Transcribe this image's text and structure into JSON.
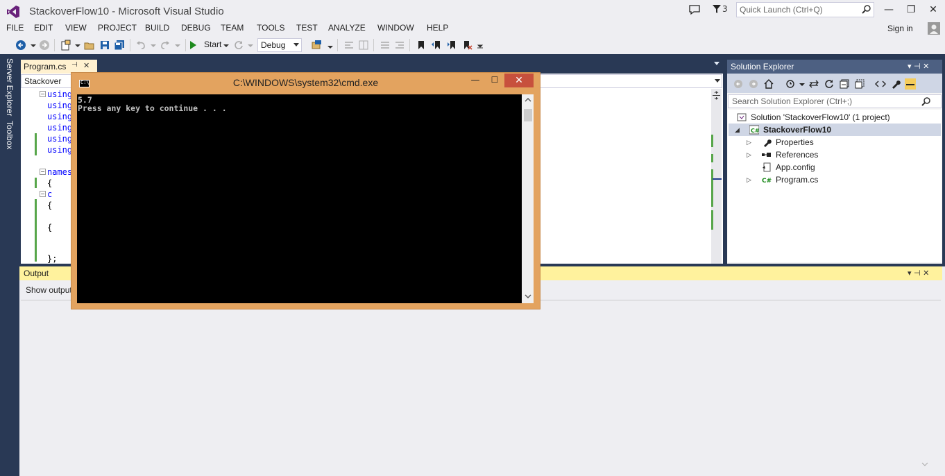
{
  "title_bar": {
    "title": "StackoverFlow10 - Microsoft Visual Studio",
    "filter_count": "3",
    "quick_launch_placeholder": "Quick Launch (Ctrl+Q)",
    "minimize": "—",
    "maximize": "❐",
    "close": "✕"
  },
  "menu": {
    "items": [
      "FILE",
      "EDIT",
      "VIEW",
      "PROJECT",
      "BUILD",
      "DEBUG",
      "TEAM",
      "TOOLS",
      "TEST",
      "ANALYZE",
      "WINDOW",
      "HELP"
    ],
    "sign_in": "Sign in"
  },
  "toolbar": {
    "start_label": "Start",
    "configuration": "Debug"
  },
  "left_tabs": {
    "server_explorer": "Server Explorer",
    "toolbox": "Toolbox"
  },
  "editor": {
    "tab_label": "Program.cs",
    "tab_pin": "⊣",
    "tab_close": "✕",
    "nav_left": "Stackover",
    "lines": [
      {
        "text": "using",
        "kind": "kw"
      },
      {
        "text": "using",
        "kind": "kw"
      },
      {
        "text": "using",
        "kind": "kw"
      },
      {
        "text": "using",
        "kind": "kw"
      },
      {
        "text": "using",
        "kind": "kw"
      },
      {
        "text": "using",
        "kind": "kw"
      },
      {
        "text": "names",
        "kind": "kw"
      },
      {
        "text": "{",
        "kind": "brace"
      },
      {
        "text": "    c",
        "kind": "kw"
      },
      {
        "text": "    {",
        "kind": "brace"
      },
      {
        "text": "{",
        "kind": "brace"
      },
      {
        "text": "};",
        "kind": "brace"
      }
    ]
  },
  "solution_explorer": {
    "title": "Solution Explorer",
    "header_icons": "▾ ⊣ ✕",
    "search_placeholder": "Search Solution Explorer (Ctrl+;)",
    "solution": "Solution 'StackoverFlow10' (1 project)",
    "project": "StackoverFlow10",
    "items": [
      "Properties",
      "References",
      "App.config",
      "Program.cs"
    ]
  },
  "output": {
    "title": "Output",
    "header_icons": "▾ ⊣ ✕",
    "show_output_label": "Show output"
  },
  "cmd": {
    "title": "C:\\WINDOWS\\system32\\cmd.exe",
    "icon_text": "C:\\",
    "minimize": "—",
    "maximize": "☐",
    "close": "✕",
    "lines": [
      "5.7",
      "Press any key to continue . . ."
    ]
  },
  "colors": {
    "chrome": "#eeeef2",
    "frame": "#293955",
    "cmd_frame": "#e3a35f",
    "cmd_close": "#c7503d",
    "output_header": "#fff29d",
    "se_header": "#4d6082"
  }
}
